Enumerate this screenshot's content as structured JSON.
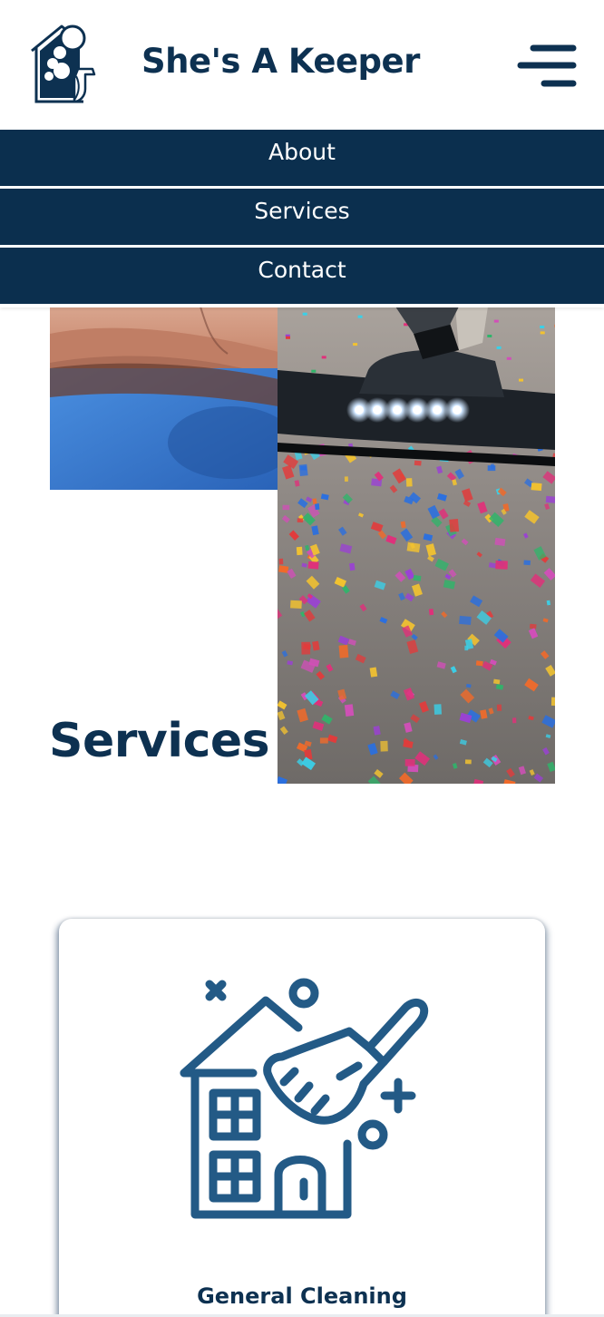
{
  "header": {
    "brand": "She's A Keeper",
    "logo_icon": "house-with-bubbles-logo",
    "menu_icon": "hamburger-menu-icon"
  },
  "nav": {
    "items": [
      {
        "label": "About"
      },
      {
        "label": "Services"
      },
      {
        "label": "Contact"
      }
    ]
  },
  "hero": {
    "title": "Services",
    "images": [
      "cleaning-person-photo",
      "vacuum-on-confetti-carpet-photo"
    ]
  },
  "services": {
    "cards": [
      {
        "title": "General Cleaning",
        "icon": "house-broom-icon"
      }
    ]
  },
  "colors": {
    "brand_navy": "#0d3151",
    "nav_bg": "#0b2f4e",
    "icon_blue": "#235a86",
    "background": "#ffffff"
  }
}
